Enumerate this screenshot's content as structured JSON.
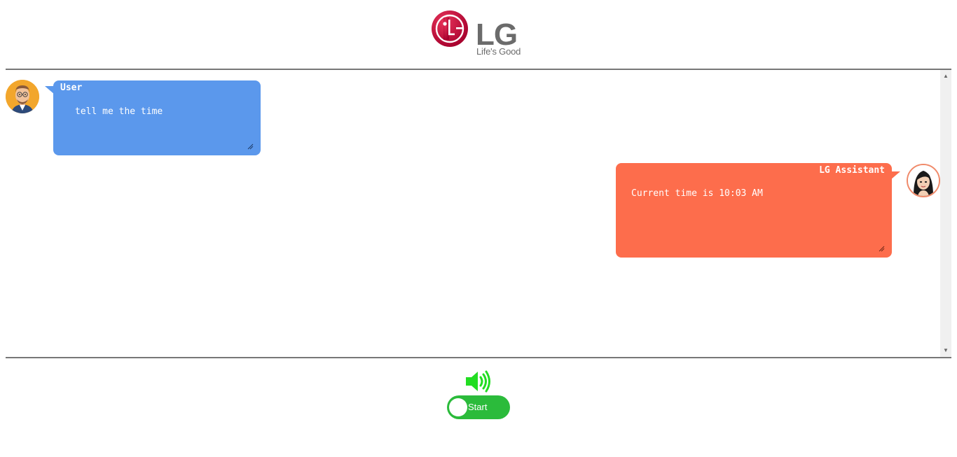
{
  "header": {
    "logo_text": "LG",
    "logo_tagline": "Life's Good"
  },
  "chat": {
    "messages": [
      {
        "sender": "User",
        "text": "tell me the time",
        "color": "#5b98ec"
      },
      {
        "sender": "LG Assistant",
        "text": "Current time is 10:03 AM",
        "color": "#fd6d4c"
      }
    ]
  },
  "controls": {
    "toggle_label": "Start",
    "toggle_color": "#2bbb3b",
    "speaker_icon": "speaker-icon",
    "speaker_color": "#22dd22"
  }
}
